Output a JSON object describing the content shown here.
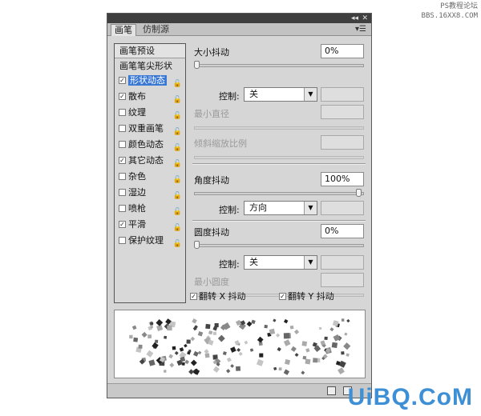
{
  "watermark": {
    "top_line1": "PS教程论坛",
    "top_line2": "BBS.16XX8.COM",
    "bottom": "UiBQ.CoM"
  },
  "panel": {
    "titlebar": {
      "collapse_glyph": "◂◂",
      "close_glyph": "✕"
    },
    "tabs": [
      {
        "label": "画笔",
        "active": true
      },
      {
        "label": "仿制源",
        "active": false
      }
    ],
    "menu_glyph": "▾☰",
    "left": {
      "preset": "画笔预设",
      "tip_shape": "画笔笔尖形状",
      "options": [
        {
          "label": "形状动态",
          "checked": true,
          "selected": true
        },
        {
          "label": "散布",
          "checked": true,
          "selected": false
        },
        {
          "label": "纹理",
          "checked": false,
          "selected": false
        },
        {
          "label": "双重画笔",
          "checked": false,
          "selected": false
        },
        {
          "label": "颜色动态",
          "checked": false,
          "selected": false
        },
        {
          "label": "其它动态",
          "checked": true,
          "selected": false
        },
        {
          "label": "杂色",
          "checked": false,
          "selected": false
        },
        {
          "label": "湿边",
          "checked": false,
          "selected": false
        },
        {
          "label": "喷枪",
          "checked": false,
          "selected": false
        },
        {
          "label": "平滑",
          "checked": true,
          "selected": false
        },
        {
          "label": "保护纹理",
          "checked": false,
          "selected": false
        }
      ],
      "lock_glyph": "🔓"
    },
    "right": {
      "size_jitter": {
        "label": "大小抖动",
        "value": "0%",
        "level": 0
      },
      "control_label": "控制:",
      "size_control": "关",
      "min_diameter": "最小直径",
      "tilt_scale": "倾斜缩放比例",
      "angle_jitter": {
        "label": "角度抖动",
        "value": "100%",
        "level": 1
      },
      "angle_control": "方向",
      "roundness_jitter": {
        "label": "圆度抖动",
        "value": "0%",
        "level": 0
      },
      "roundness_control": "关",
      "min_roundness": "最小圆度",
      "flip_x": {
        "label": "翻转 X 抖动",
        "checked": true
      },
      "flip_y": {
        "label": "翻转 Y 抖动",
        "checked": true
      }
    },
    "check_glyph": "✓",
    "arrow_glyph": "▼"
  }
}
